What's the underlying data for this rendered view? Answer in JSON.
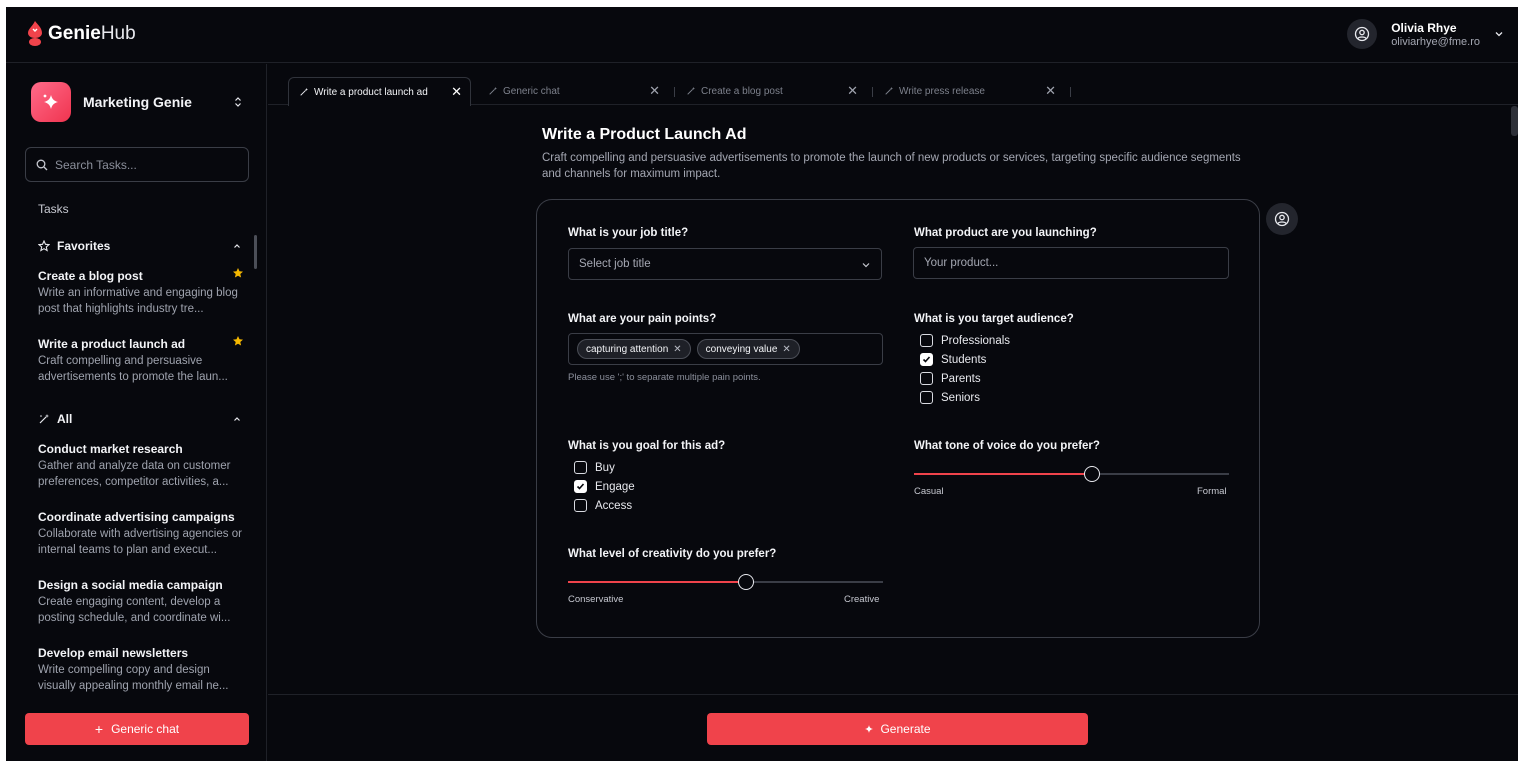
{
  "app": {
    "logo_bold": "Genie",
    "logo_light": "Hub",
    "colors": {
      "accent": "#f0434b",
      "background": "#07080d",
      "border": "#3a3d46",
      "star": "#f5b800"
    }
  },
  "user": {
    "name": "Olivia Rhye",
    "email": "oliviarhye@fme.ro"
  },
  "sidebar": {
    "genie_name": "Marketing Genie",
    "search_placeholder": "Search Tasks...",
    "tasks_label": "Tasks",
    "favorites_label": "Favorites",
    "all_label": "All",
    "favorites": [
      {
        "title": "Create a blog post",
        "desc": "Write an informative and engaging blog post that highlights industry tre..."
      },
      {
        "title": "Write a product launch ad",
        "desc": "Craft compelling and persuasive advertisements to promote the laun..."
      }
    ],
    "all": [
      {
        "title": "Conduct market research",
        "desc": "Gather and analyze data on customer preferences, competitor activities, a..."
      },
      {
        "title": "Coordinate advertising campaigns",
        "desc": "Collaborate with advertising agencies or internal teams to plan and execut..."
      },
      {
        "title": "Design a social media campaign",
        "desc": "Create engaging content, develop a posting schedule, and coordinate wi..."
      },
      {
        "title": "Develop email newsletters",
        "desc": "Write compelling copy and design visually appealing monthly email ne..."
      }
    ],
    "generic_chat_label": "Generic chat"
  },
  "tabs": [
    {
      "label": "Write a product launch ad",
      "active": true
    },
    {
      "label": "Generic chat",
      "active": false
    },
    {
      "label": "Create a blog post",
      "active": false
    },
    {
      "label": "Write press release",
      "active": false
    }
  ],
  "main": {
    "title": "Write a Product Launch Ad",
    "description": "Craft compelling and persuasive advertisements to promote the launch of new products or services, targeting specific audience segments and channels for maximum impact.",
    "job_title": {
      "question": "What is your job title?",
      "placeholder": "Select job title"
    },
    "product": {
      "question": "What product are you launching?",
      "placeholder": "Your product..."
    },
    "pain_points": {
      "question": "What are your pain points?",
      "chips": [
        "capturing attention",
        "conveying value"
      ],
      "hint": "Please use ';' to separate multiple pain points."
    },
    "audience": {
      "question": "What is you target audience?",
      "options": [
        {
          "label": "Professionals",
          "checked": false
        },
        {
          "label": "Students",
          "checked": true
        },
        {
          "label": "Parents",
          "checked": false
        },
        {
          "label": "Seniors",
          "checked": false
        }
      ]
    },
    "goal": {
      "question": "What is you goal for this ad?",
      "options": [
        {
          "label": "Buy",
          "checked": false
        },
        {
          "label": "Engage",
          "checked": true
        },
        {
          "label": "Access",
          "checked": false
        }
      ]
    },
    "tone": {
      "question": "What tone of voice do you prefer?",
      "min_label": "Casual",
      "max_label": "Formal",
      "value": 0.565
    },
    "creativity": {
      "question": "What level of creativity do you prefer?",
      "min_label": "Conservative",
      "max_label": "Creative",
      "value": 0.565
    },
    "generate_label": "Generate"
  }
}
